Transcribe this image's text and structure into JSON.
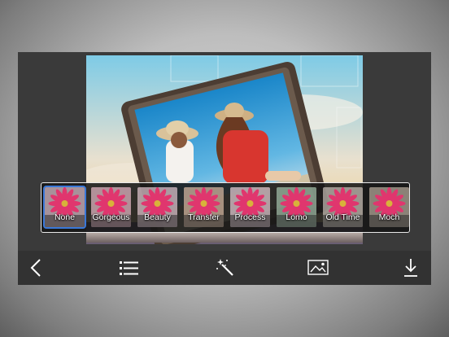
{
  "filters": [
    {
      "label": "None",
      "selected": true,
      "tone": "#e8b4c8"
    },
    {
      "label": "Gorgeous",
      "selected": false,
      "tone": "#f0a0b8"
    },
    {
      "label": "Beauty",
      "selected": false,
      "tone": "#e8b9c9"
    },
    {
      "label": "Transfer",
      "selected": false,
      "tone": "#d9a37a"
    },
    {
      "label": "Process",
      "selected": false,
      "tone": "#f3c6d6"
    },
    {
      "label": "Lomo",
      "selected": false,
      "tone": "#7fb08a"
    },
    {
      "label": "Old Time",
      "selected": false,
      "tone": "#b9ab9c"
    },
    {
      "label": "Moch",
      "selected": false,
      "tone": "#a48d73"
    }
  ],
  "toolbar": [
    {
      "name": "back-icon"
    },
    {
      "name": "list-icon"
    },
    {
      "name": "magic-wand-icon"
    },
    {
      "name": "image-icon"
    },
    {
      "name": "download-icon"
    }
  ],
  "colors": {
    "app_bg": "#3a3a3a",
    "toolbar_bg": "#323232",
    "selection": "#3a78d8",
    "sky": "#4aa8d6",
    "frame": "#5a4a3e"
  }
}
